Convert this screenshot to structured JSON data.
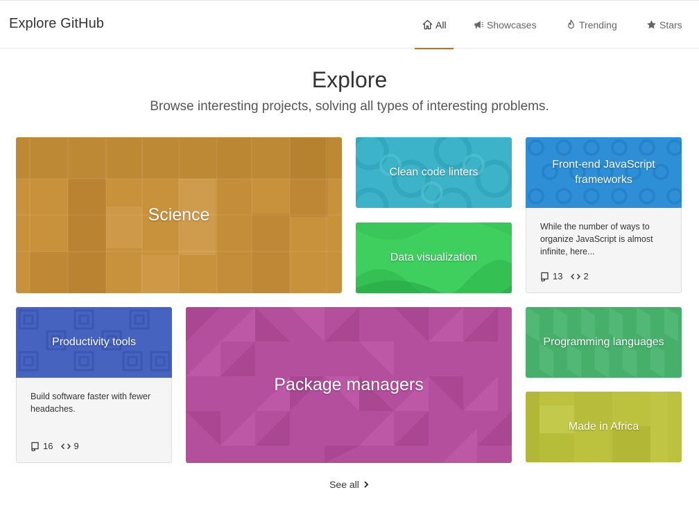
{
  "header": {
    "title": "Explore GitHub",
    "nav": [
      {
        "label": "All",
        "icon": "home-icon",
        "selected": true
      },
      {
        "label": "Showcases",
        "icon": "megaphone-icon",
        "selected": false
      },
      {
        "label": "Trending",
        "icon": "flame-icon",
        "selected": false
      },
      {
        "label": "Stars",
        "icon": "star-icon",
        "selected": false
      }
    ],
    "accent_color": "#d26911"
  },
  "hero": {
    "title": "Explore",
    "subtitle": "Browse interesting projects, solving all types of interesting problems."
  },
  "cards": {
    "science": {
      "label": "Science",
      "color": "#c8923d"
    },
    "linters": {
      "label": "Clean code linters",
      "color": "#3cb3c8"
    },
    "dataviz": {
      "label": "Data visualization",
      "color": "#3fcf5f"
    },
    "frontend": {
      "label": "Front-end JavaScript frameworks",
      "color": "#2f8fd6",
      "description": "While the number of ways to organize JavaScript is almost infinite, here...",
      "repos": "13",
      "languages": "2"
    },
    "productivity": {
      "label": "Productivity tools",
      "color": "#4663c0",
      "description": "Build software faster with fewer headaches.",
      "repos": "16",
      "languages": "9"
    },
    "packages": {
      "label": "Package managers",
      "color": "#b44f9d"
    },
    "languages": {
      "label": "Programming languages",
      "color": "#46b06a"
    },
    "africa": {
      "label": "Made in Africa",
      "color": "#bcc23d"
    }
  },
  "footer": {
    "see_all": "See all"
  }
}
